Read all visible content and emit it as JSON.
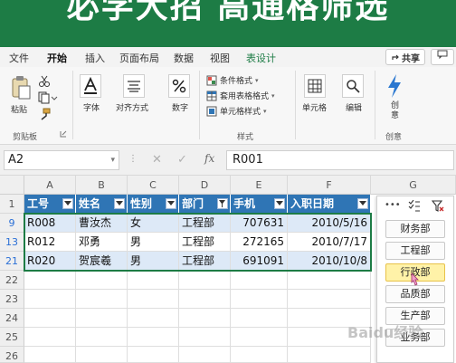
{
  "banner": {
    "title": "必学大招 高通格筛选"
  },
  "ribbon_tabs": [
    "文件",
    "开始",
    "插入",
    "页面布局",
    "数据",
    "视图",
    "表设计"
  ],
  "share_label": "共享",
  "ribbon": {
    "paste_label": "粘贴",
    "clipboard_label": "剪贴板",
    "font_label": "字体",
    "alignment_label": "对齐方式",
    "number_label": "数字",
    "cond_format_label": "条件格式",
    "table_format_label": "套用表格格式",
    "cell_style_label": "单元格样式",
    "styles_group_label": "样式",
    "cells_label": "单元格",
    "editing_label": "编辑",
    "create_label": "创意",
    "create_group_label": "创意"
  },
  "formula_bar": {
    "name_box": "A2",
    "value": "R001"
  },
  "grid": {
    "columns": [
      "A",
      "B",
      "C",
      "D",
      "E",
      "F",
      "G"
    ],
    "row_numbers": [
      "1",
      "9",
      "13",
      "21",
      "22",
      "23",
      "24",
      "25",
      "26"
    ],
    "headers": [
      "工号",
      "姓名",
      "性别",
      "部门",
      "手机",
      "入职日期"
    ],
    "rows": [
      [
        "R008",
        "曹汝杰",
        "女",
        "工程部",
        "707631",
        "2010/5/16"
      ],
      [
        "R012",
        "邓勇",
        "男",
        "工程部",
        "272165",
        "2010/7/17"
      ],
      [
        "R020",
        "贺宸羲",
        "男",
        "工程部",
        "691091",
        "2010/10/8"
      ]
    ]
  },
  "slicer": {
    "items": [
      "财务部",
      "工程部",
      "行政部",
      "品质部",
      "生产部",
      "业务部"
    ],
    "selected": "行政部"
  },
  "watermark": "Baidu经验",
  "colors": {
    "banner": "#1d7c45",
    "table_header": "#2f75b5",
    "band": "#dde9f7",
    "slicer_selected": "#fff2a8"
  }
}
